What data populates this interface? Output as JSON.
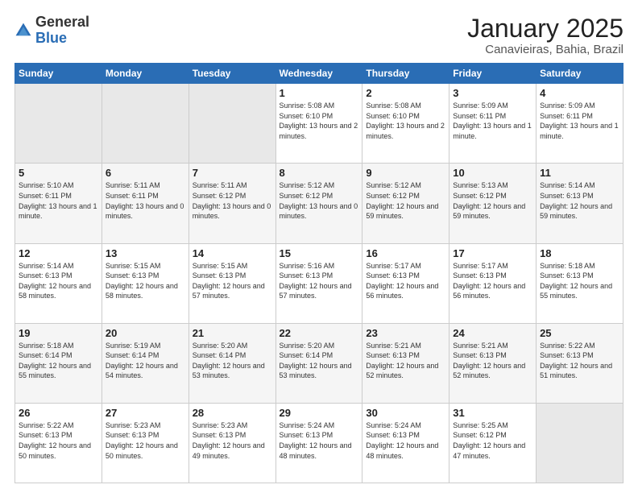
{
  "logo": {
    "general": "General",
    "blue": "Blue"
  },
  "header": {
    "title": "January 2025",
    "subtitle": "Canavieiras, Bahia, Brazil"
  },
  "weekdays": [
    "Sunday",
    "Monday",
    "Tuesday",
    "Wednesday",
    "Thursday",
    "Friday",
    "Saturday"
  ],
  "weeks": [
    [
      {
        "day": "",
        "sunrise": "",
        "sunset": "",
        "daylight": ""
      },
      {
        "day": "",
        "sunrise": "",
        "sunset": "",
        "daylight": ""
      },
      {
        "day": "",
        "sunrise": "",
        "sunset": "",
        "daylight": ""
      },
      {
        "day": "1",
        "sunrise": "Sunrise: 5:08 AM",
        "sunset": "Sunset: 6:10 PM",
        "daylight": "Daylight: 13 hours and 2 minutes."
      },
      {
        "day": "2",
        "sunrise": "Sunrise: 5:08 AM",
        "sunset": "Sunset: 6:10 PM",
        "daylight": "Daylight: 13 hours and 2 minutes."
      },
      {
        "day": "3",
        "sunrise": "Sunrise: 5:09 AM",
        "sunset": "Sunset: 6:11 PM",
        "daylight": "Daylight: 13 hours and 1 minute."
      },
      {
        "day": "4",
        "sunrise": "Sunrise: 5:09 AM",
        "sunset": "Sunset: 6:11 PM",
        "daylight": "Daylight: 13 hours and 1 minute."
      }
    ],
    [
      {
        "day": "5",
        "sunrise": "Sunrise: 5:10 AM",
        "sunset": "Sunset: 6:11 PM",
        "daylight": "Daylight: 13 hours and 1 minute."
      },
      {
        "day": "6",
        "sunrise": "Sunrise: 5:11 AM",
        "sunset": "Sunset: 6:11 PM",
        "daylight": "Daylight: 13 hours and 0 minutes."
      },
      {
        "day": "7",
        "sunrise": "Sunrise: 5:11 AM",
        "sunset": "Sunset: 6:12 PM",
        "daylight": "Daylight: 13 hours and 0 minutes."
      },
      {
        "day": "8",
        "sunrise": "Sunrise: 5:12 AM",
        "sunset": "Sunset: 6:12 PM",
        "daylight": "Daylight: 13 hours and 0 minutes."
      },
      {
        "day": "9",
        "sunrise": "Sunrise: 5:12 AM",
        "sunset": "Sunset: 6:12 PM",
        "daylight": "Daylight: 12 hours and 59 minutes."
      },
      {
        "day": "10",
        "sunrise": "Sunrise: 5:13 AM",
        "sunset": "Sunset: 6:12 PM",
        "daylight": "Daylight: 12 hours and 59 minutes."
      },
      {
        "day": "11",
        "sunrise": "Sunrise: 5:14 AM",
        "sunset": "Sunset: 6:13 PM",
        "daylight": "Daylight: 12 hours and 59 minutes."
      }
    ],
    [
      {
        "day": "12",
        "sunrise": "Sunrise: 5:14 AM",
        "sunset": "Sunset: 6:13 PM",
        "daylight": "Daylight: 12 hours and 58 minutes."
      },
      {
        "day": "13",
        "sunrise": "Sunrise: 5:15 AM",
        "sunset": "Sunset: 6:13 PM",
        "daylight": "Daylight: 12 hours and 58 minutes."
      },
      {
        "day": "14",
        "sunrise": "Sunrise: 5:15 AM",
        "sunset": "Sunset: 6:13 PM",
        "daylight": "Daylight: 12 hours and 57 minutes."
      },
      {
        "day": "15",
        "sunrise": "Sunrise: 5:16 AM",
        "sunset": "Sunset: 6:13 PM",
        "daylight": "Daylight: 12 hours and 57 minutes."
      },
      {
        "day": "16",
        "sunrise": "Sunrise: 5:17 AM",
        "sunset": "Sunset: 6:13 PM",
        "daylight": "Daylight: 12 hours and 56 minutes."
      },
      {
        "day": "17",
        "sunrise": "Sunrise: 5:17 AM",
        "sunset": "Sunset: 6:13 PM",
        "daylight": "Daylight: 12 hours and 56 minutes."
      },
      {
        "day": "18",
        "sunrise": "Sunrise: 5:18 AM",
        "sunset": "Sunset: 6:13 PM",
        "daylight": "Daylight: 12 hours and 55 minutes."
      }
    ],
    [
      {
        "day": "19",
        "sunrise": "Sunrise: 5:18 AM",
        "sunset": "Sunset: 6:14 PM",
        "daylight": "Daylight: 12 hours and 55 minutes."
      },
      {
        "day": "20",
        "sunrise": "Sunrise: 5:19 AM",
        "sunset": "Sunset: 6:14 PM",
        "daylight": "Daylight: 12 hours and 54 minutes."
      },
      {
        "day": "21",
        "sunrise": "Sunrise: 5:20 AM",
        "sunset": "Sunset: 6:14 PM",
        "daylight": "Daylight: 12 hours and 53 minutes."
      },
      {
        "day": "22",
        "sunrise": "Sunrise: 5:20 AM",
        "sunset": "Sunset: 6:14 PM",
        "daylight": "Daylight: 12 hours and 53 minutes."
      },
      {
        "day": "23",
        "sunrise": "Sunrise: 5:21 AM",
        "sunset": "Sunset: 6:13 PM",
        "daylight": "Daylight: 12 hours and 52 minutes."
      },
      {
        "day": "24",
        "sunrise": "Sunrise: 5:21 AM",
        "sunset": "Sunset: 6:13 PM",
        "daylight": "Daylight: 12 hours and 52 minutes."
      },
      {
        "day": "25",
        "sunrise": "Sunrise: 5:22 AM",
        "sunset": "Sunset: 6:13 PM",
        "daylight": "Daylight: 12 hours and 51 minutes."
      }
    ],
    [
      {
        "day": "26",
        "sunrise": "Sunrise: 5:22 AM",
        "sunset": "Sunset: 6:13 PM",
        "daylight": "Daylight: 12 hours and 50 minutes."
      },
      {
        "day": "27",
        "sunrise": "Sunrise: 5:23 AM",
        "sunset": "Sunset: 6:13 PM",
        "daylight": "Daylight: 12 hours and 50 minutes."
      },
      {
        "day": "28",
        "sunrise": "Sunrise: 5:23 AM",
        "sunset": "Sunset: 6:13 PM",
        "daylight": "Daylight: 12 hours and 49 minutes."
      },
      {
        "day": "29",
        "sunrise": "Sunrise: 5:24 AM",
        "sunset": "Sunset: 6:13 PM",
        "daylight": "Daylight: 12 hours and 48 minutes."
      },
      {
        "day": "30",
        "sunrise": "Sunrise: 5:24 AM",
        "sunset": "Sunset: 6:13 PM",
        "daylight": "Daylight: 12 hours and 48 minutes."
      },
      {
        "day": "31",
        "sunrise": "Sunrise: 5:25 AM",
        "sunset": "Sunset: 6:12 PM",
        "daylight": "Daylight: 12 hours and 47 minutes."
      },
      {
        "day": "",
        "sunrise": "",
        "sunset": "",
        "daylight": ""
      }
    ]
  ]
}
